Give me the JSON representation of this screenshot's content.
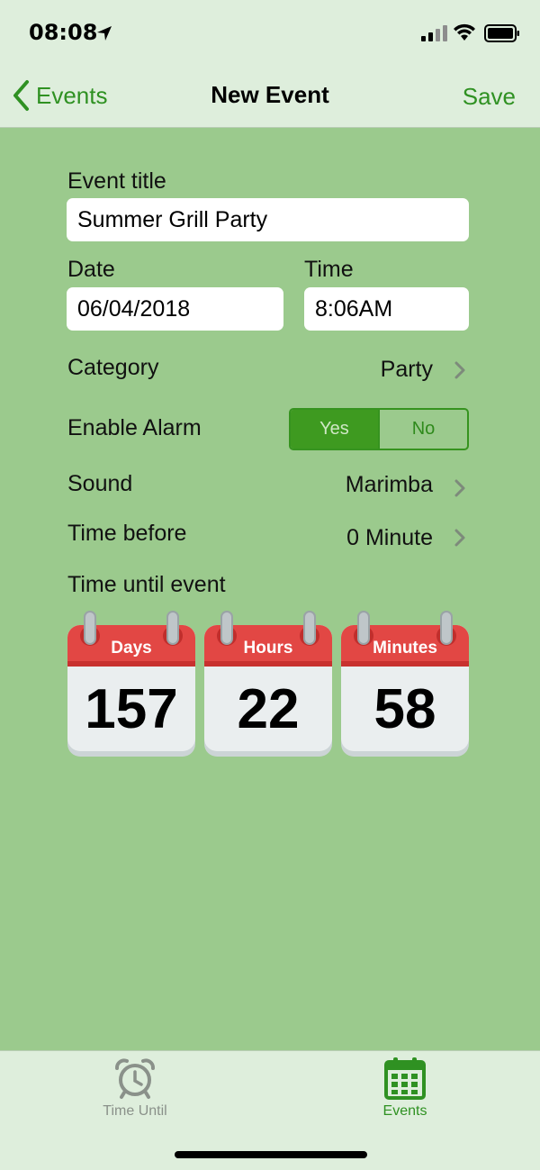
{
  "status_bar": {
    "time": "08:08"
  },
  "nav": {
    "back_label": "Events",
    "title": "New Event",
    "save_label": "Save"
  },
  "form": {
    "event_title_label": "Event title",
    "event_title_value": "Summer Grill Party",
    "date_label": "Date",
    "date_value": "06/04/2018",
    "time_label": "Time",
    "time_value": "8:06AM",
    "category_label": "Category",
    "category_value": "Party",
    "alarm_label": "Enable Alarm",
    "alarm_options": [
      "Yes",
      "No"
    ],
    "alarm_selected": "Yes",
    "sound_label": "Sound",
    "sound_value": "Marimba",
    "time_before_label": "Time before",
    "time_before_value": "0 Minute",
    "countdown_label": "Time until event"
  },
  "countdown": [
    {
      "unit": "Days",
      "value": "157"
    },
    {
      "unit": "Hours",
      "value": "22"
    },
    {
      "unit": "Minutes",
      "value": "58"
    }
  ],
  "tabs": [
    {
      "label": "Time Until",
      "icon": "alarm-clock-icon",
      "active": false
    },
    {
      "label": "Events",
      "icon": "calendar-icon",
      "active": true
    }
  ],
  "colors": {
    "accent": "#2f9122",
    "background": "#9bca8d",
    "bar": "#deeedc",
    "calendar_red": "#e24744",
    "inactive_tab": "#8a918a"
  }
}
